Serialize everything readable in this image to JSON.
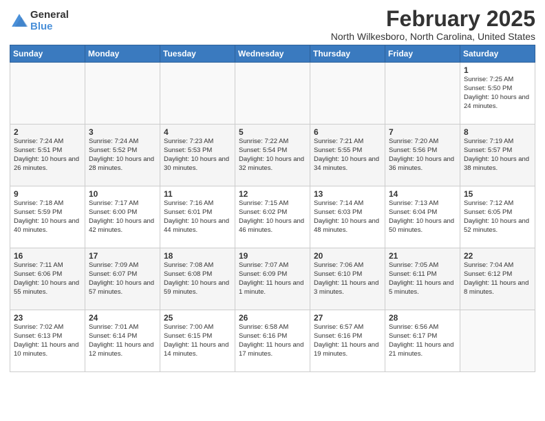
{
  "logo": {
    "general": "General",
    "blue": "Blue"
  },
  "header": {
    "title": "February 2025",
    "location": "North Wilkesboro, North Carolina, United States"
  },
  "days": [
    "Sunday",
    "Monday",
    "Tuesday",
    "Wednesday",
    "Thursday",
    "Friday",
    "Saturday"
  ],
  "weeks": [
    [
      {
        "day": "",
        "info": ""
      },
      {
        "day": "",
        "info": ""
      },
      {
        "day": "",
        "info": ""
      },
      {
        "day": "",
        "info": ""
      },
      {
        "day": "",
        "info": ""
      },
      {
        "day": "",
        "info": ""
      },
      {
        "day": "1",
        "info": "Sunrise: 7:25 AM\nSunset: 5:50 PM\nDaylight: 10 hours\nand 24 minutes."
      }
    ],
    [
      {
        "day": "2",
        "info": "Sunrise: 7:24 AM\nSunset: 5:51 PM\nDaylight: 10 hours\nand 26 minutes."
      },
      {
        "day": "3",
        "info": "Sunrise: 7:24 AM\nSunset: 5:52 PM\nDaylight: 10 hours\nand 28 minutes."
      },
      {
        "day": "4",
        "info": "Sunrise: 7:23 AM\nSunset: 5:53 PM\nDaylight: 10 hours\nand 30 minutes."
      },
      {
        "day": "5",
        "info": "Sunrise: 7:22 AM\nSunset: 5:54 PM\nDaylight: 10 hours\nand 32 minutes."
      },
      {
        "day": "6",
        "info": "Sunrise: 7:21 AM\nSunset: 5:55 PM\nDaylight: 10 hours\nand 34 minutes."
      },
      {
        "day": "7",
        "info": "Sunrise: 7:20 AM\nSunset: 5:56 PM\nDaylight: 10 hours\nand 36 minutes."
      },
      {
        "day": "8",
        "info": "Sunrise: 7:19 AM\nSunset: 5:57 PM\nDaylight: 10 hours\nand 38 minutes."
      }
    ],
    [
      {
        "day": "9",
        "info": "Sunrise: 7:18 AM\nSunset: 5:59 PM\nDaylight: 10 hours\nand 40 minutes."
      },
      {
        "day": "10",
        "info": "Sunrise: 7:17 AM\nSunset: 6:00 PM\nDaylight: 10 hours\nand 42 minutes."
      },
      {
        "day": "11",
        "info": "Sunrise: 7:16 AM\nSunset: 6:01 PM\nDaylight: 10 hours\nand 44 minutes."
      },
      {
        "day": "12",
        "info": "Sunrise: 7:15 AM\nSunset: 6:02 PM\nDaylight: 10 hours\nand 46 minutes."
      },
      {
        "day": "13",
        "info": "Sunrise: 7:14 AM\nSunset: 6:03 PM\nDaylight: 10 hours\nand 48 minutes."
      },
      {
        "day": "14",
        "info": "Sunrise: 7:13 AM\nSunset: 6:04 PM\nDaylight: 10 hours\nand 50 minutes."
      },
      {
        "day": "15",
        "info": "Sunrise: 7:12 AM\nSunset: 6:05 PM\nDaylight: 10 hours\nand 52 minutes."
      }
    ],
    [
      {
        "day": "16",
        "info": "Sunrise: 7:11 AM\nSunset: 6:06 PM\nDaylight: 10 hours\nand 55 minutes."
      },
      {
        "day": "17",
        "info": "Sunrise: 7:09 AM\nSunset: 6:07 PM\nDaylight: 10 hours\nand 57 minutes."
      },
      {
        "day": "18",
        "info": "Sunrise: 7:08 AM\nSunset: 6:08 PM\nDaylight: 10 hours\nand 59 minutes."
      },
      {
        "day": "19",
        "info": "Sunrise: 7:07 AM\nSunset: 6:09 PM\nDaylight: 11 hours\nand 1 minute."
      },
      {
        "day": "20",
        "info": "Sunrise: 7:06 AM\nSunset: 6:10 PM\nDaylight: 11 hours\nand 3 minutes."
      },
      {
        "day": "21",
        "info": "Sunrise: 7:05 AM\nSunset: 6:11 PM\nDaylight: 11 hours\nand 5 minutes."
      },
      {
        "day": "22",
        "info": "Sunrise: 7:04 AM\nSunset: 6:12 PM\nDaylight: 11 hours\nand 8 minutes."
      }
    ],
    [
      {
        "day": "23",
        "info": "Sunrise: 7:02 AM\nSunset: 6:13 PM\nDaylight: 11 hours\nand 10 minutes."
      },
      {
        "day": "24",
        "info": "Sunrise: 7:01 AM\nSunset: 6:14 PM\nDaylight: 11 hours\nand 12 minutes."
      },
      {
        "day": "25",
        "info": "Sunrise: 7:00 AM\nSunset: 6:15 PM\nDaylight: 11 hours\nand 14 minutes."
      },
      {
        "day": "26",
        "info": "Sunrise: 6:58 AM\nSunset: 6:16 PM\nDaylight: 11 hours\nand 17 minutes."
      },
      {
        "day": "27",
        "info": "Sunrise: 6:57 AM\nSunset: 6:16 PM\nDaylight: 11 hours\nand 19 minutes."
      },
      {
        "day": "28",
        "info": "Sunrise: 6:56 AM\nSunset: 6:17 PM\nDaylight: 11 hours\nand 21 minutes."
      },
      {
        "day": "",
        "info": ""
      }
    ]
  ]
}
